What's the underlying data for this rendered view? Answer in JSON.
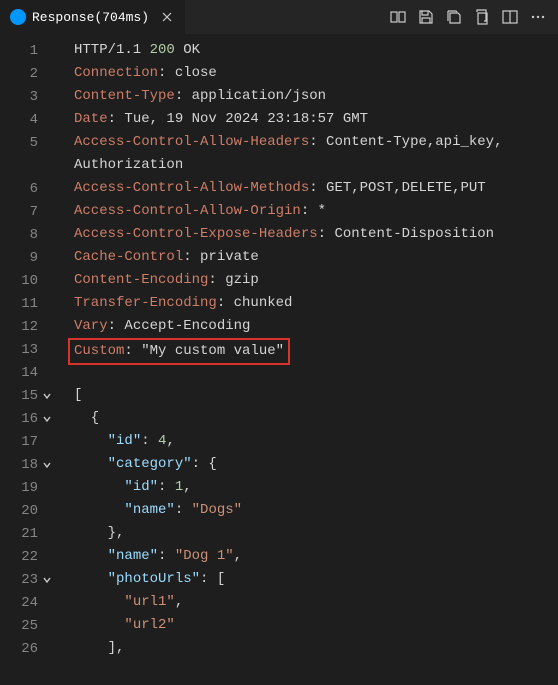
{
  "tab": {
    "label": "Response(704ms)",
    "icon": "http"
  },
  "code": {
    "lines": [
      {
        "n": 1,
        "fold": "",
        "segs": [
          {
            "t": "HTTP/1.1 ",
            "c": "tok-text"
          },
          {
            "t": "200",
            "c": "tok-green"
          },
          {
            "t": " OK",
            "c": "tok-text"
          }
        ]
      },
      {
        "n": 2,
        "fold": "",
        "segs": [
          {
            "t": "Connection",
            "c": "tok-header"
          },
          {
            "t": ": close",
            "c": "tok-text"
          }
        ]
      },
      {
        "n": 3,
        "fold": "",
        "segs": [
          {
            "t": "Content-Type",
            "c": "tok-header"
          },
          {
            "t": ": application/json",
            "c": "tok-text"
          }
        ]
      },
      {
        "n": 4,
        "fold": "",
        "segs": [
          {
            "t": "Date",
            "c": "tok-header"
          },
          {
            "t": ": Tue, 19 Nov 2024 23:18:57 GMT",
            "c": "tok-text"
          }
        ]
      },
      {
        "n": 5,
        "fold": "",
        "segs": [
          {
            "t": "Access-Control-Allow-Headers",
            "c": "tok-header"
          },
          {
            "t": ": Content-Type,api_key,",
            "c": "tok-text"
          }
        ]
      },
      {
        "n": null,
        "fold": "",
        "segs": [
          {
            "t": "Authorization",
            "c": "tok-text"
          }
        ]
      },
      {
        "n": 6,
        "fold": "",
        "segs": [
          {
            "t": "Access-Control-Allow-Methods",
            "c": "tok-header"
          },
          {
            "t": ": GET,POST,DELETE,PUT",
            "c": "tok-text"
          }
        ]
      },
      {
        "n": 7,
        "fold": "",
        "segs": [
          {
            "t": "Access-Control-Allow-Origin",
            "c": "tok-header"
          },
          {
            "t": ": *",
            "c": "tok-text"
          }
        ]
      },
      {
        "n": 8,
        "fold": "",
        "segs": [
          {
            "t": "Access-Control-Expose-Headers",
            "c": "tok-header"
          },
          {
            "t": ": Content-Disposition",
            "c": "tok-text"
          }
        ]
      },
      {
        "n": 9,
        "fold": "",
        "segs": [
          {
            "t": "Cache-Control",
            "c": "tok-header"
          },
          {
            "t": ": private",
            "c": "tok-text"
          }
        ]
      },
      {
        "n": 10,
        "fold": "",
        "segs": [
          {
            "t": "Content-Encoding",
            "c": "tok-header"
          },
          {
            "t": ": gzip",
            "c": "tok-text"
          }
        ]
      },
      {
        "n": 11,
        "fold": "",
        "segs": [
          {
            "t": "Transfer-Encoding",
            "c": "tok-header"
          },
          {
            "t": ": chunked",
            "c": "tok-text"
          }
        ]
      },
      {
        "n": 12,
        "fold": "",
        "segs": [
          {
            "t": "Vary",
            "c": "tok-header"
          },
          {
            "t": ": Accept-Encoding",
            "c": "tok-text"
          }
        ]
      },
      {
        "n": 13,
        "fold": "",
        "highlight": true,
        "segs": [
          {
            "t": "Custom",
            "c": "tok-header"
          },
          {
            "t": ": \"My custom value\"",
            "c": "tok-text"
          }
        ]
      },
      {
        "n": 14,
        "fold": "",
        "segs": []
      },
      {
        "n": 15,
        "fold": "v",
        "segs": [
          {
            "t": "[",
            "c": "tok-punct"
          }
        ]
      },
      {
        "n": 16,
        "fold": "v",
        "segs": [
          {
            "t": "  {",
            "c": "tok-punct"
          }
        ]
      },
      {
        "n": 17,
        "fold": "",
        "segs": [
          {
            "t": "    ",
            "c": "tok-punct"
          },
          {
            "t": "\"id\"",
            "c": "tok-prop"
          },
          {
            "t": ": ",
            "c": "tok-punct"
          },
          {
            "t": "4",
            "c": "tok-num"
          },
          {
            "t": ",",
            "c": "tok-punct"
          }
        ]
      },
      {
        "n": 18,
        "fold": "v",
        "segs": [
          {
            "t": "    ",
            "c": "tok-punct"
          },
          {
            "t": "\"category\"",
            "c": "tok-prop"
          },
          {
            "t": ": {",
            "c": "tok-punct"
          }
        ]
      },
      {
        "n": 19,
        "fold": "",
        "segs": [
          {
            "t": "      ",
            "c": "tok-punct"
          },
          {
            "t": "\"id\"",
            "c": "tok-prop"
          },
          {
            "t": ": ",
            "c": "tok-punct"
          },
          {
            "t": "1",
            "c": "tok-num"
          },
          {
            "t": ",",
            "c": "tok-punct"
          }
        ]
      },
      {
        "n": 20,
        "fold": "",
        "segs": [
          {
            "t": "      ",
            "c": "tok-punct"
          },
          {
            "t": "\"name\"",
            "c": "tok-prop"
          },
          {
            "t": ": ",
            "c": "tok-punct"
          },
          {
            "t": "\"Dogs\"",
            "c": "tok-str"
          }
        ]
      },
      {
        "n": 21,
        "fold": "",
        "segs": [
          {
            "t": "    },",
            "c": "tok-punct"
          }
        ]
      },
      {
        "n": 22,
        "fold": "",
        "segs": [
          {
            "t": "    ",
            "c": "tok-punct"
          },
          {
            "t": "\"name\"",
            "c": "tok-prop"
          },
          {
            "t": ": ",
            "c": "tok-punct"
          },
          {
            "t": "\"Dog 1\"",
            "c": "tok-str"
          },
          {
            "t": ",",
            "c": "tok-punct"
          }
        ]
      },
      {
        "n": 23,
        "fold": "v",
        "segs": [
          {
            "t": "    ",
            "c": "tok-punct"
          },
          {
            "t": "\"photoUrls\"",
            "c": "tok-prop"
          },
          {
            "t": ": [",
            "c": "tok-punct"
          }
        ]
      },
      {
        "n": 24,
        "fold": "",
        "segs": [
          {
            "t": "      ",
            "c": "tok-punct"
          },
          {
            "t": "\"url1\"",
            "c": "tok-str"
          },
          {
            "t": ",",
            "c": "tok-punct"
          }
        ]
      },
      {
        "n": 25,
        "fold": "",
        "segs": [
          {
            "t": "      ",
            "c": "tok-punct"
          },
          {
            "t": "\"url2\"",
            "c": "tok-str"
          }
        ]
      },
      {
        "n": 26,
        "fold": "",
        "segs": [
          {
            "t": "    ],",
            "c": "tok-punct"
          }
        ]
      }
    ]
  }
}
